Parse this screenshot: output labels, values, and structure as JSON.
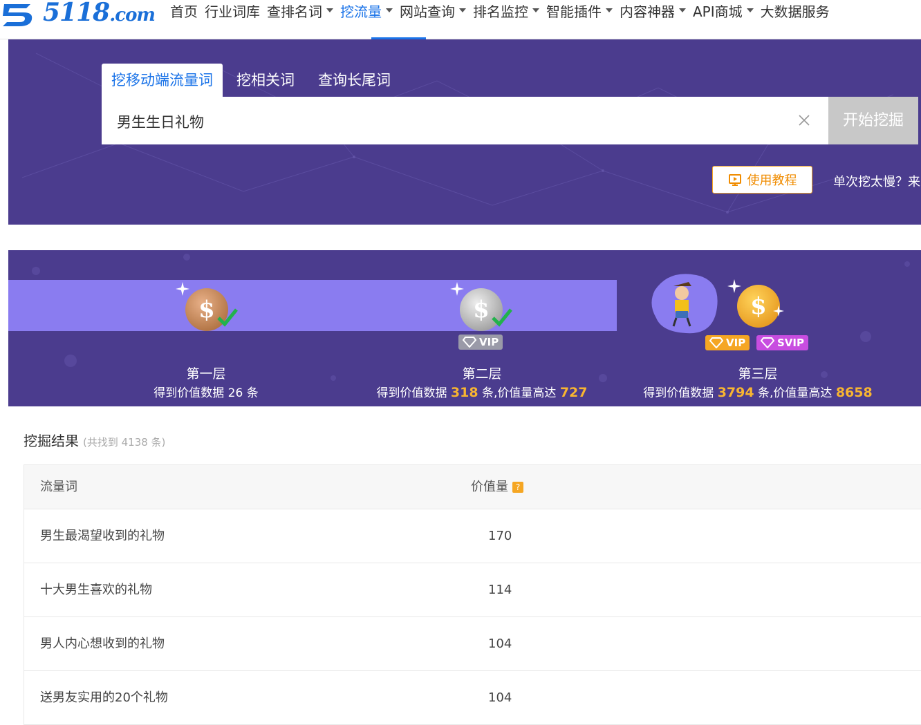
{
  "logo": {
    "text": "5118",
    "suffix": ".com"
  },
  "nav": {
    "items": [
      {
        "label": "首页",
        "caret": false,
        "active": false
      },
      {
        "label": "行业词库",
        "caret": false,
        "active": false
      },
      {
        "label": "查排名词",
        "caret": true,
        "active": false
      },
      {
        "label": "挖流量",
        "caret": true,
        "active": true
      },
      {
        "label": "网站查询",
        "caret": true,
        "active": false
      },
      {
        "label": "排名监控",
        "caret": true,
        "active": false
      },
      {
        "label": "智能插件",
        "caret": true,
        "active": false
      },
      {
        "label": "内容神器",
        "caret": true,
        "active": false
      },
      {
        "label": "API商城",
        "caret": true,
        "active": false
      },
      {
        "label": "大数据服务",
        "caret": false,
        "active": false
      }
    ]
  },
  "search": {
    "tabs": [
      {
        "label": "挖移动端流量词",
        "active": true
      },
      {
        "label": "挖相关词",
        "active": false
      },
      {
        "label": "查询长尾词",
        "active": false
      }
    ],
    "query": "男生生日礼物",
    "button_label": "开始挖掘",
    "tutorial_label": "使用教程",
    "slow_text": "单次挖太慢？来"
  },
  "levels": [
    {
      "title": "第一层",
      "desc_prefix": "得到价值数据 ",
      "count": "26",
      "desc_mid": " 条",
      "value_prefix": "",
      "value": ""
    },
    {
      "title": "第二层",
      "desc_prefix": "得到价值数据 ",
      "count": "318",
      "desc_mid": " 条,价值量高达 ",
      "value": "727",
      "badge": "VIP"
    },
    {
      "title": "第三层",
      "desc_prefix": "得到价值数据 ",
      "count": "3794",
      "desc_mid": " 条,价值量高达 ",
      "value": "8658",
      "badges": [
        "VIP",
        "SVIP"
      ]
    }
  ],
  "results": {
    "title": "挖掘结果",
    "count_text": "(共找到 4138 条)",
    "columns": [
      "流量词",
      "价值量"
    ],
    "help_icon": "?",
    "rows": [
      {
        "keyword": "男生最渴望收到的礼物",
        "value": "170"
      },
      {
        "keyword": "十大男生喜欢的礼物",
        "value": "114"
      },
      {
        "keyword": "男人内心想收到的礼物",
        "value": "104"
      },
      {
        "keyword": "送男友实用的20个礼物",
        "value": "104"
      }
    ]
  },
  "colors": {
    "brand": "#1a73e8",
    "banner_bg": "#4b3c8e",
    "band": "#8a7cf0",
    "highlight": "#f8b531",
    "tutorial": "#f08c00"
  }
}
